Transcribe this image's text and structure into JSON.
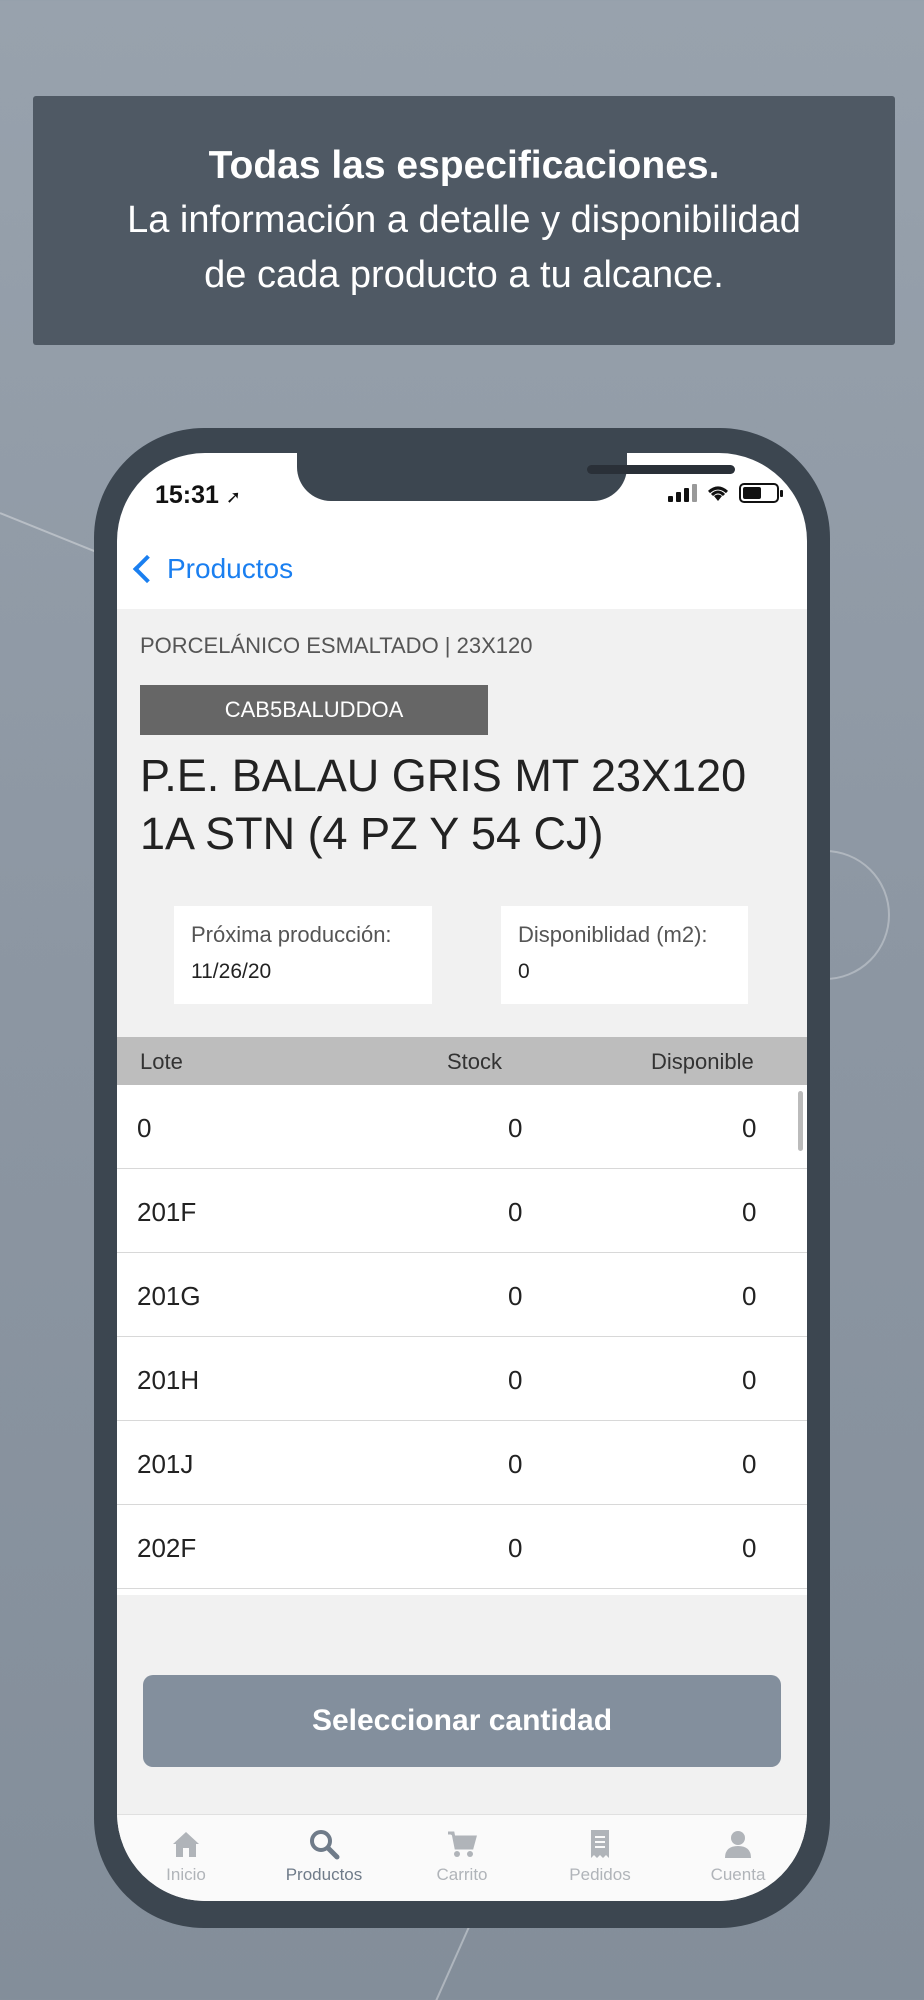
{
  "banner": {
    "title": "Todas las especificaciones.",
    "line1": "La información a detalle y disponibilidad",
    "line2": "de cada producto a tu alcance."
  },
  "status": {
    "time": "15:31"
  },
  "nav": {
    "back_label": "Productos"
  },
  "product": {
    "category": "PORCELÁNICO ESMALTADO | 23X120",
    "sku": "CAB5BALUDDOA",
    "title_line1": "P.E. BALAU GRIS MT 23X120",
    "title_line2": "1A STN (4 PZ Y 54 CJ)",
    "next_production_label": "Próxima producción:",
    "next_production_value": "11/26/20",
    "availability_label": "Disponiblidad (m2):",
    "availability_value": "0"
  },
  "table": {
    "headers": [
      "Lote",
      "Stock",
      "Disponible"
    ],
    "rows": [
      [
        "0",
        "0",
        "0"
      ],
      [
        "201F",
        "0",
        "0"
      ],
      [
        "201G",
        "0",
        "0"
      ],
      [
        "201H",
        "0",
        "0"
      ],
      [
        "201J",
        "0",
        "0"
      ],
      [
        "202F",
        "0",
        "0"
      ]
    ]
  },
  "action": {
    "select_label": "Seleccionar cantidad"
  },
  "tabs": [
    {
      "label": "Inicio",
      "icon": "home-icon"
    },
    {
      "label": "Productos",
      "icon": "search-icon",
      "active": true
    },
    {
      "label": "Carrito",
      "icon": "cart-icon"
    },
    {
      "label": "Pedidos",
      "icon": "receipt-icon"
    },
    {
      "label": "Cuenta",
      "icon": "user-icon"
    }
  ],
  "colors": {
    "accent": "#1a7ff0",
    "button": "#838f9d",
    "banner": "#4f5964"
  }
}
